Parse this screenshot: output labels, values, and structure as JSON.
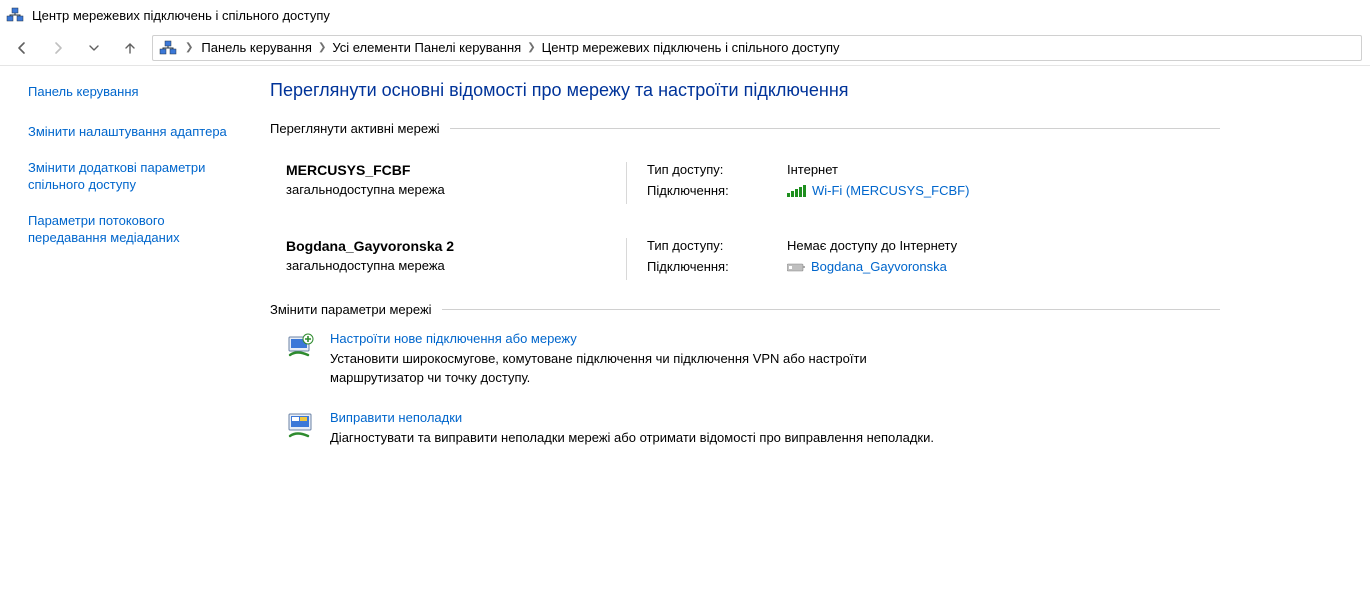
{
  "window_title": "Центр мережевих підключень і спільного доступу",
  "breadcrumb": {
    "items": [
      "Панель керування",
      "Усі елементи Панелі керування",
      "Центр мережевих підключень і спільного доступу"
    ]
  },
  "sidebar": {
    "home": "Панель керування",
    "links": [
      "Змінити налаштування адаптера",
      "Змінити додаткові параметри спільного доступу",
      "Параметри потокового передавання медіаданих"
    ]
  },
  "main": {
    "heading": "Переглянути основні відомості про мережу та настроїти підключення",
    "active_section": "Переглянути активні мережі",
    "access_label": "Тип доступу:",
    "conn_label": "Підключення:",
    "networks": [
      {
        "name": "MERCUSYS_FCBF",
        "category": "загальнодоступна мережа",
        "access": "Інтернет",
        "conn_icon": "wifi",
        "conn_name": "Wi-Fi (MERCUSYS_FCBF)"
      },
      {
        "name": "Bogdana_Gayvoronska 2",
        "category": "загальнодоступна мережа",
        "access": "Немає доступу до Інтернету",
        "conn_icon": "ethernet",
        "conn_name": "Bogdana_Gayvoronska"
      }
    ],
    "change_section": "Змінити параметри мережі",
    "tasks": [
      {
        "title": "Настроїти нове підключення або мережу",
        "desc": "Установити широкосмугове, комутоване підключення чи підключення VPN або настроїти маршрутизатор чи точку доступу."
      },
      {
        "title": "Виправити неполадки",
        "desc": "Діагностувати та виправити неполадки мережі або отримати відомості про виправлення неполадки."
      }
    ]
  }
}
